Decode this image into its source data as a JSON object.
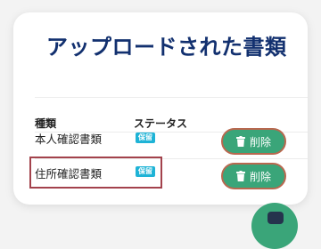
{
  "card": {
    "title": "アップロードされた書類"
  },
  "table": {
    "headers": [
      "種類",
      "ステータス"
    ],
    "rows": [
      {
        "name": "本人確認書類",
        "status": "保留",
        "action": "削除"
      },
      {
        "name": "住所確認書類",
        "status": "保留",
        "action": "削除"
      }
    ]
  },
  "colors": {
    "title": "#12306f",
    "status_badge": "#1eb3d6",
    "delete_button": "#3aa579",
    "highlight_border": "#a3424c"
  },
  "icons": {
    "delete": "trash-icon",
    "fab": "chat-icon"
  }
}
